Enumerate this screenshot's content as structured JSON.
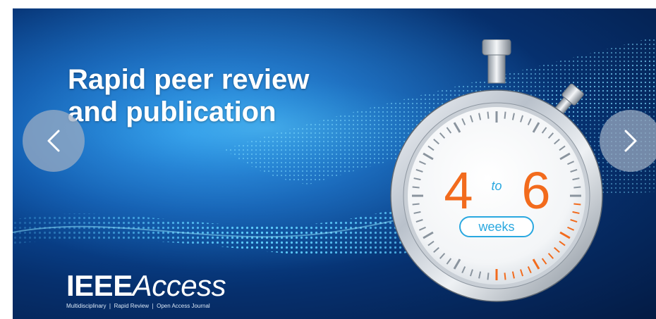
{
  "banner": {
    "headline_line1": "Rapid peer review",
    "headline_line2": "and publication"
  },
  "stopwatch": {
    "from": "4",
    "connector": "to",
    "to": "6",
    "unit": "weeks"
  },
  "brand": {
    "name_bold": "IEEE",
    "name_light": "Access",
    "tagline": "Multidisciplinary ❘ Rapid Review ❘ Open Access Journal"
  },
  "carousel": {
    "prev_icon": "chevron-left-icon",
    "next_icon": "chevron-right-icon"
  },
  "colors": {
    "accent_orange": "#f26b1d",
    "accent_blue": "#2aa8e0",
    "banner_dark": "#041b44",
    "banner_light": "#1e7fd6"
  }
}
